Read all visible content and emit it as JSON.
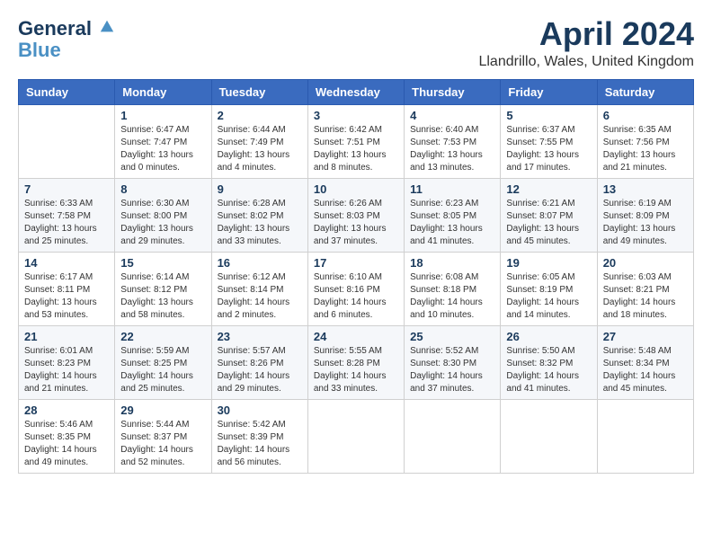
{
  "logo": {
    "line1": "General",
    "line2": "Blue"
  },
  "title": "April 2024",
  "location": "Llandrillo, Wales, United Kingdom",
  "headers": [
    "Sunday",
    "Monday",
    "Tuesday",
    "Wednesday",
    "Thursday",
    "Friday",
    "Saturday"
  ],
  "weeks": [
    [
      {
        "day": "",
        "info": ""
      },
      {
        "day": "1",
        "info": "Sunrise: 6:47 AM\nSunset: 7:47 PM\nDaylight: 13 hours\nand 0 minutes."
      },
      {
        "day": "2",
        "info": "Sunrise: 6:44 AM\nSunset: 7:49 PM\nDaylight: 13 hours\nand 4 minutes."
      },
      {
        "day": "3",
        "info": "Sunrise: 6:42 AM\nSunset: 7:51 PM\nDaylight: 13 hours\nand 8 minutes."
      },
      {
        "day": "4",
        "info": "Sunrise: 6:40 AM\nSunset: 7:53 PM\nDaylight: 13 hours\nand 13 minutes."
      },
      {
        "day": "5",
        "info": "Sunrise: 6:37 AM\nSunset: 7:55 PM\nDaylight: 13 hours\nand 17 minutes."
      },
      {
        "day": "6",
        "info": "Sunrise: 6:35 AM\nSunset: 7:56 PM\nDaylight: 13 hours\nand 21 minutes."
      }
    ],
    [
      {
        "day": "7",
        "info": "Sunrise: 6:33 AM\nSunset: 7:58 PM\nDaylight: 13 hours\nand 25 minutes."
      },
      {
        "day": "8",
        "info": "Sunrise: 6:30 AM\nSunset: 8:00 PM\nDaylight: 13 hours\nand 29 minutes."
      },
      {
        "day": "9",
        "info": "Sunrise: 6:28 AM\nSunset: 8:02 PM\nDaylight: 13 hours\nand 33 minutes."
      },
      {
        "day": "10",
        "info": "Sunrise: 6:26 AM\nSunset: 8:03 PM\nDaylight: 13 hours\nand 37 minutes."
      },
      {
        "day": "11",
        "info": "Sunrise: 6:23 AM\nSunset: 8:05 PM\nDaylight: 13 hours\nand 41 minutes."
      },
      {
        "day": "12",
        "info": "Sunrise: 6:21 AM\nSunset: 8:07 PM\nDaylight: 13 hours\nand 45 minutes."
      },
      {
        "day": "13",
        "info": "Sunrise: 6:19 AM\nSunset: 8:09 PM\nDaylight: 13 hours\nand 49 minutes."
      }
    ],
    [
      {
        "day": "14",
        "info": "Sunrise: 6:17 AM\nSunset: 8:11 PM\nDaylight: 13 hours\nand 53 minutes."
      },
      {
        "day": "15",
        "info": "Sunrise: 6:14 AM\nSunset: 8:12 PM\nDaylight: 13 hours\nand 58 minutes."
      },
      {
        "day": "16",
        "info": "Sunrise: 6:12 AM\nSunset: 8:14 PM\nDaylight: 14 hours\nand 2 minutes."
      },
      {
        "day": "17",
        "info": "Sunrise: 6:10 AM\nSunset: 8:16 PM\nDaylight: 14 hours\nand 6 minutes."
      },
      {
        "day": "18",
        "info": "Sunrise: 6:08 AM\nSunset: 8:18 PM\nDaylight: 14 hours\nand 10 minutes."
      },
      {
        "day": "19",
        "info": "Sunrise: 6:05 AM\nSunset: 8:19 PM\nDaylight: 14 hours\nand 14 minutes."
      },
      {
        "day": "20",
        "info": "Sunrise: 6:03 AM\nSunset: 8:21 PM\nDaylight: 14 hours\nand 18 minutes."
      }
    ],
    [
      {
        "day": "21",
        "info": "Sunrise: 6:01 AM\nSunset: 8:23 PM\nDaylight: 14 hours\nand 21 minutes."
      },
      {
        "day": "22",
        "info": "Sunrise: 5:59 AM\nSunset: 8:25 PM\nDaylight: 14 hours\nand 25 minutes."
      },
      {
        "day": "23",
        "info": "Sunrise: 5:57 AM\nSunset: 8:26 PM\nDaylight: 14 hours\nand 29 minutes."
      },
      {
        "day": "24",
        "info": "Sunrise: 5:55 AM\nSunset: 8:28 PM\nDaylight: 14 hours\nand 33 minutes."
      },
      {
        "day": "25",
        "info": "Sunrise: 5:52 AM\nSunset: 8:30 PM\nDaylight: 14 hours\nand 37 minutes."
      },
      {
        "day": "26",
        "info": "Sunrise: 5:50 AM\nSunset: 8:32 PM\nDaylight: 14 hours\nand 41 minutes."
      },
      {
        "day": "27",
        "info": "Sunrise: 5:48 AM\nSunset: 8:34 PM\nDaylight: 14 hours\nand 45 minutes."
      }
    ],
    [
      {
        "day": "28",
        "info": "Sunrise: 5:46 AM\nSunset: 8:35 PM\nDaylight: 14 hours\nand 49 minutes."
      },
      {
        "day": "29",
        "info": "Sunrise: 5:44 AM\nSunset: 8:37 PM\nDaylight: 14 hours\nand 52 minutes."
      },
      {
        "day": "30",
        "info": "Sunrise: 5:42 AM\nSunset: 8:39 PM\nDaylight: 14 hours\nand 56 minutes."
      },
      {
        "day": "",
        "info": ""
      },
      {
        "day": "",
        "info": ""
      },
      {
        "day": "",
        "info": ""
      },
      {
        "day": "",
        "info": ""
      }
    ]
  ]
}
